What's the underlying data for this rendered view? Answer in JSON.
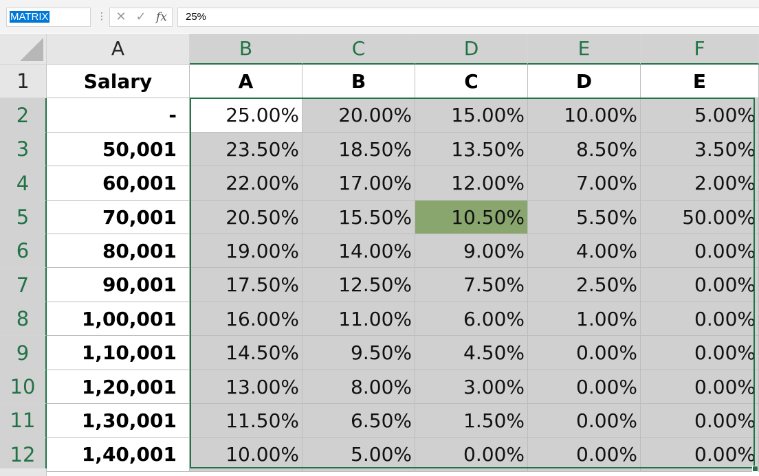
{
  "formula_bar": {
    "name_box": "MATRIX",
    "cancel_icon": "close-icon",
    "enter_icon": "check-icon",
    "fx_label": "fx",
    "formula": "25%"
  },
  "sheet": {
    "column_headers": [
      "A",
      "B",
      "C",
      "D",
      "E",
      "F"
    ],
    "row_headers": [
      "1",
      "2",
      "3",
      "4",
      "5",
      "6",
      "7",
      "8",
      "9",
      "10",
      "11",
      "12"
    ],
    "header_row": [
      "Salary",
      "A",
      "B",
      "C",
      "D",
      "E"
    ],
    "rows": [
      {
        "salary": "-",
        "values": [
          "25.00%",
          "20.00%",
          "15.00%",
          "10.00%",
          "5.00%"
        ]
      },
      {
        "salary": "50,001",
        "values": [
          "23.50%",
          "18.50%",
          "13.50%",
          "8.50%",
          "3.50%"
        ]
      },
      {
        "salary": "60,001",
        "values": [
          "22.00%",
          "17.00%",
          "12.00%",
          "7.00%",
          "2.00%"
        ]
      },
      {
        "salary": "70,001",
        "values": [
          "20.50%",
          "15.50%",
          "10.50%",
          "5.50%",
          "50.00%"
        ]
      },
      {
        "salary": "80,001",
        "values": [
          "19.00%",
          "14.00%",
          "9.00%",
          "4.00%",
          "0.00%"
        ]
      },
      {
        "salary": "90,001",
        "values": [
          "17.50%",
          "12.50%",
          "7.50%",
          "2.50%",
          "0.00%"
        ]
      },
      {
        "salary": "1,00,001",
        "values": [
          "16.00%",
          "11.00%",
          "6.00%",
          "1.00%",
          "0.00%"
        ]
      },
      {
        "salary": "1,10,001",
        "values": [
          "14.50%",
          "9.50%",
          "4.50%",
          "0.00%",
          "0.00%"
        ]
      },
      {
        "salary": "1,20,001",
        "values": [
          "13.00%",
          "8.00%",
          "3.00%",
          "0.00%",
          "0.00%"
        ]
      },
      {
        "salary": "1,30,001",
        "values": [
          "11.50%",
          "6.50%",
          "1.50%",
          "0.00%",
          "0.00%"
        ]
      },
      {
        "salary": "1,40,001",
        "values": [
          "10.00%",
          "5.00%",
          "0.00%",
          "0.00%",
          "0.00%"
        ]
      }
    ],
    "active_cell": "B2",
    "highlighted_cell": "D5",
    "selection_range": "B2:F12",
    "colors": {
      "selection_border": "#217346",
      "selected_fill": "#d0d0d0",
      "highlight_fill": "#8aa66f"
    }
  }
}
